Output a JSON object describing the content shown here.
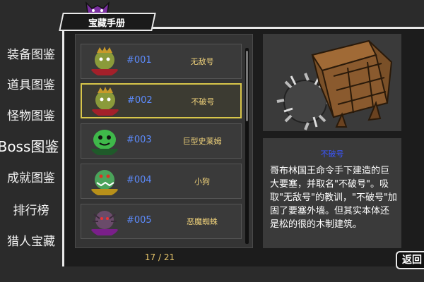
{
  "header": {
    "title": "宝藏手册"
  },
  "nav": {
    "items": [
      {
        "label": "装备图鉴"
      },
      {
        "label": "道具图鉴"
      },
      {
        "label": "怪物图鉴"
      },
      {
        "label": "Boss图鉴",
        "active": true
      },
      {
        "label": "成就图鉴"
      },
      {
        "label": "排行榜"
      },
      {
        "label": "猎人宝藏"
      }
    ]
  },
  "list": {
    "rows": [
      {
        "num": "#001",
        "name": "无敌号",
        "avatar_label": "KING OF GOBLIN",
        "avatar_color": "#8a9a3a"
      },
      {
        "num": "#002",
        "name": "不破号",
        "avatar_label": "KING OF GOBLIN",
        "avatar_color": "#8a9a3a",
        "selected": true
      },
      {
        "num": "#003",
        "name": "巨型史莱姆",
        "avatar_label": "BOSS SLIME",
        "avatar_color": "#3fb84a"
      },
      {
        "num": "#004",
        "name": "小狗",
        "avatar_label": "THE PUPPY",
        "avatar_color": "#4aa35a"
      },
      {
        "num": "#005",
        "name": "恶魔蜘蛛",
        "avatar_label": "DEMON SPIDER",
        "avatar_color": "#6a4b6a"
      }
    ],
    "pager": "17 / 21"
  },
  "detail": {
    "title": "不破号",
    "description": "哥布林国王命令手下建造的巨大要塞，并取名\"不破号\"。吸取\"无敌号\"的教训，\"不破号\"加固了要塞外墙。但其实本体还是松的很的木制建筑。"
  },
  "back_button": {
    "label": "返回"
  },
  "colors": {
    "accent_number": "#5d8cff",
    "name_text": "#f0d27a",
    "selected_border": "#d8c64a",
    "detail_title": "#3a56ff"
  }
}
